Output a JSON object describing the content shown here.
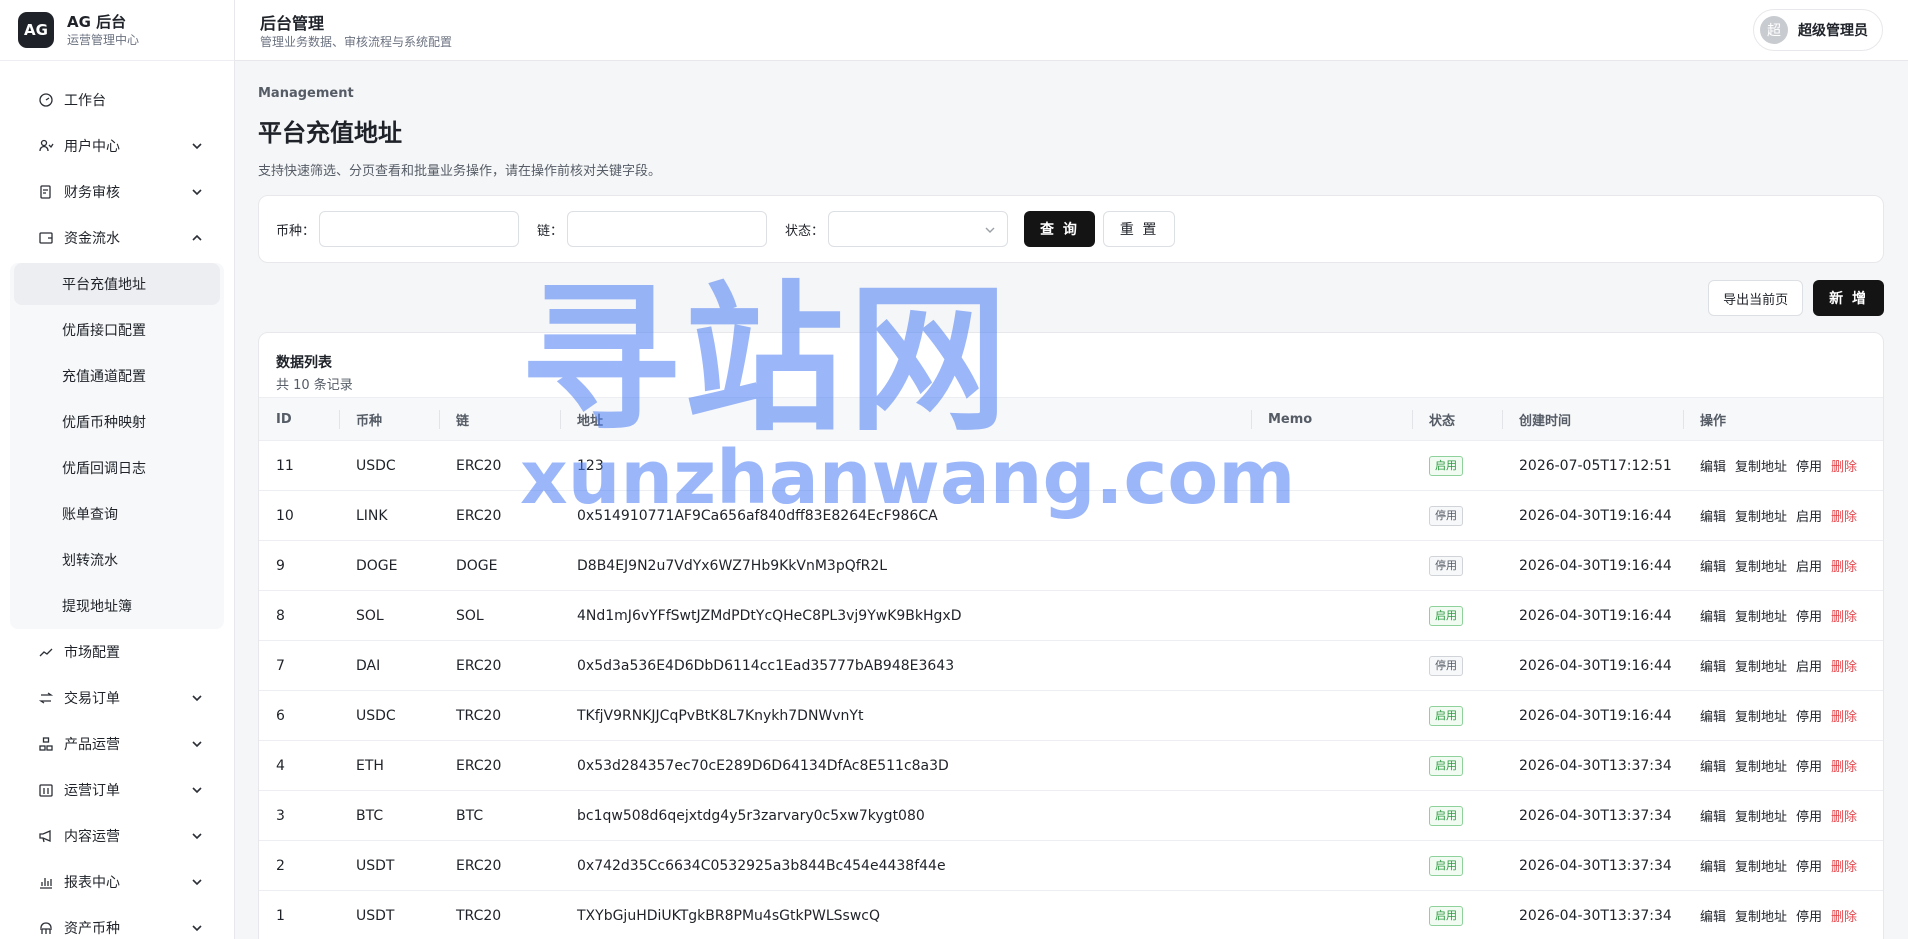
{
  "brand": {
    "logo": "AG",
    "title": "AG 后台",
    "subtitle": "运营管理中心"
  },
  "header": {
    "title": "后台管理",
    "subtitle": "管理业务数据、审核流程与系统配置"
  },
  "user": {
    "avatar_char": "超",
    "name": "超级管理员"
  },
  "sidebar": {
    "items_top": [
      {
        "label": "工作台",
        "icon": "dashboard-icon",
        "has_chevron": false
      },
      {
        "label": "用户中心",
        "icon": "user-icon",
        "has_chevron": true
      },
      {
        "label": "财务审核",
        "icon": "audit-icon",
        "has_chevron": true
      },
      {
        "label": "资金流水",
        "icon": "wallet-icon",
        "has_chevron": true,
        "expanded": true
      }
    ],
    "sub_items": [
      {
        "label": "平台充值地址",
        "active": true
      },
      {
        "label": "优盾接口配置"
      },
      {
        "label": "充值通道配置"
      },
      {
        "label": "优盾币种映射"
      },
      {
        "label": "优盾回调日志"
      },
      {
        "label": "账单查询"
      },
      {
        "label": "划转流水"
      },
      {
        "label": "提现地址簿"
      }
    ],
    "items_bottom": [
      {
        "label": "市场配置",
        "icon": "chart-line-icon",
        "has_chevron": false
      },
      {
        "label": "交易订单",
        "icon": "swap-icon",
        "has_chevron": true
      },
      {
        "label": "产品运营",
        "icon": "product-icon",
        "has_chevron": true
      },
      {
        "label": "运营订单",
        "icon": "calendar-icon",
        "has_chevron": true
      },
      {
        "label": "内容运营",
        "icon": "megaphone-icon",
        "has_chevron": true
      },
      {
        "label": "报表中心",
        "icon": "bar-chart-icon",
        "has_chevron": true
      },
      {
        "label": "资产币种",
        "icon": "coin-icon",
        "has_chevron": true
      }
    ]
  },
  "page": {
    "eyebrow": "Management",
    "title": "平台充值地址",
    "description": "支持快速筛选、分页查看和批量业务操作，请在操作前核对关键字段。"
  },
  "filters": {
    "currency_label": "币种：",
    "currency_value": "",
    "chain_label": "链：",
    "chain_value": "",
    "status_label": "状态：",
    "status_value": "",
    "query_button": "查 询",
    "reset_button": "重 置"
  },
  "actions": {
    "export_button": "导出当前页",
    "new_button": "新 增"
  },
  "table": {
    "title": "数据列表",
    "count_text": "共 10 条记录",
    "columns": [
      "ID",
      "币种",
      "链",
      "地址",
      "Memo",
      "状态",
      "创建时间",
      "操作"
    ],
    "rows": [
      {
        "id": "11",
        "currency": "USDC",
        "chain": "ERC20",
        "address": "123",
        "memo": "",
        "status": "启用",
        "enabled": true,
        "created": "2026-07-05T17:12:51",
        "toggle": "停用"
      },
      {
        "id": "10",
        "currency": "LINK",
        "chain": "ERC20",
        "address": "0x514910771AF9Ca656af840dff83E8264EcF986CA",
        "memo": "",
        "status": "停用",
        "enabled": false,
        "created": "2026-04-30T19:16:44",
        "toggle": "启用"
      },
      {
        "id": "9",
        "currency": "DOGE",
        "chain": "DOGE",
        "address": "D8B4EJ9N2u7VdYx6WZ7Hb9KkVnM3pQfR2L",
        "memo": "",
        "status": "停用",
        "enabled": false,
        "created": "2026-04-30T19:16:44",
        "toggle": "启用"
      },
      {
        "id": "8",
        "currency": "SOL",
        "chain": "SOL",
        "address": "4Nd1mJ6vYFfSwtJZMdPDtYcQHeC8PL3vj9YwK9BkHgxD",
        "memo": "",
        "status": "启用",
        "enabled": true,
        "created": "2026-04-30T19:16:44",
        "toggle": "停用"
      },
      {
        "id": "7",
        "currency": "DAI",
        "chain": "ERC20",
        "address": "0x5d3a536E4D6DbD6114cc1Ead35777bAB948E3643",
        "memo": "",
        "status": "停用",
        "enabled": false,
        "created": "2026-04-30T19:16:44",
        "toggle": "启用"
      },
      {
        "id": "6",
        "currency": "USDC",
        "chain": "TRC20",
        "address": "TKfjV9RNKJJCqPvBtK8L7Knykh7DNWvnYt",
        "memo": "",
        "status": "启用",
        "enabled": true,
        "created": "2026-04-30T19:16:44",
        "toggle": "停用"
      },
      {
        "id": "4",
        "currency": "ETH",
        "chain": "ERC20",
        "address": "0x53d284357ec70cE289D6D64134DfAc8E511c8a3D",
        "memo": "",
        "status": "启用",
        "enabled": true,
        "created": "2026-04-30T13:37:34",
        "toggle": "停用"
      },
      {
        "id": "3",
        "currency": "BTC",
        "chain": "BTC",
        "address": "bc1qw508d6qejxtdg4y5r3zarvary0c5xw7kygt080",
        "memo": "",
        "status": "启用",
        "enabled": true,
        "created": "2026-04-30T13:37:34",
        "toggle": "停用"
      },
      {
        "id": "2",
        "currency": "USDT",
        "chain": "ERC20",
        "address": "0x742d35Cc6634C0532925a3b844Bc454e4438f44e",
        "memo": "",
        "status": "启用",
        "enabled": true,
        "created": "2026-04-30T13:37:34",
        "toggle": "停用"
      },
      {
        "id": "1",
        "currency": "USDT",
        "chain": "TRC20",
        "address": "TXYbGjuHDiUKTgkBR8PMu4sGtkPWLSswcQ",
        "memo": "",
        "status": "启用",
        "enabled": true,
        "created": "2026-04-30T13:37:34",
        "toggle": "停用"
      }
    ],
    "op_labels": {
      "edit": "编辑",
      "copy": "复制地址",
      "delete": "删除"
    }
  },
  "watermark": {
    "cn": "寻站网",
    "en": "xunzhanwang.com"
  },
  "colors": {
    "primary_dark": "#141414",
    "success": "#2e9a41",
    "danger": "#e5484d",
    "watermark": "#4a7df5"
  }
}
